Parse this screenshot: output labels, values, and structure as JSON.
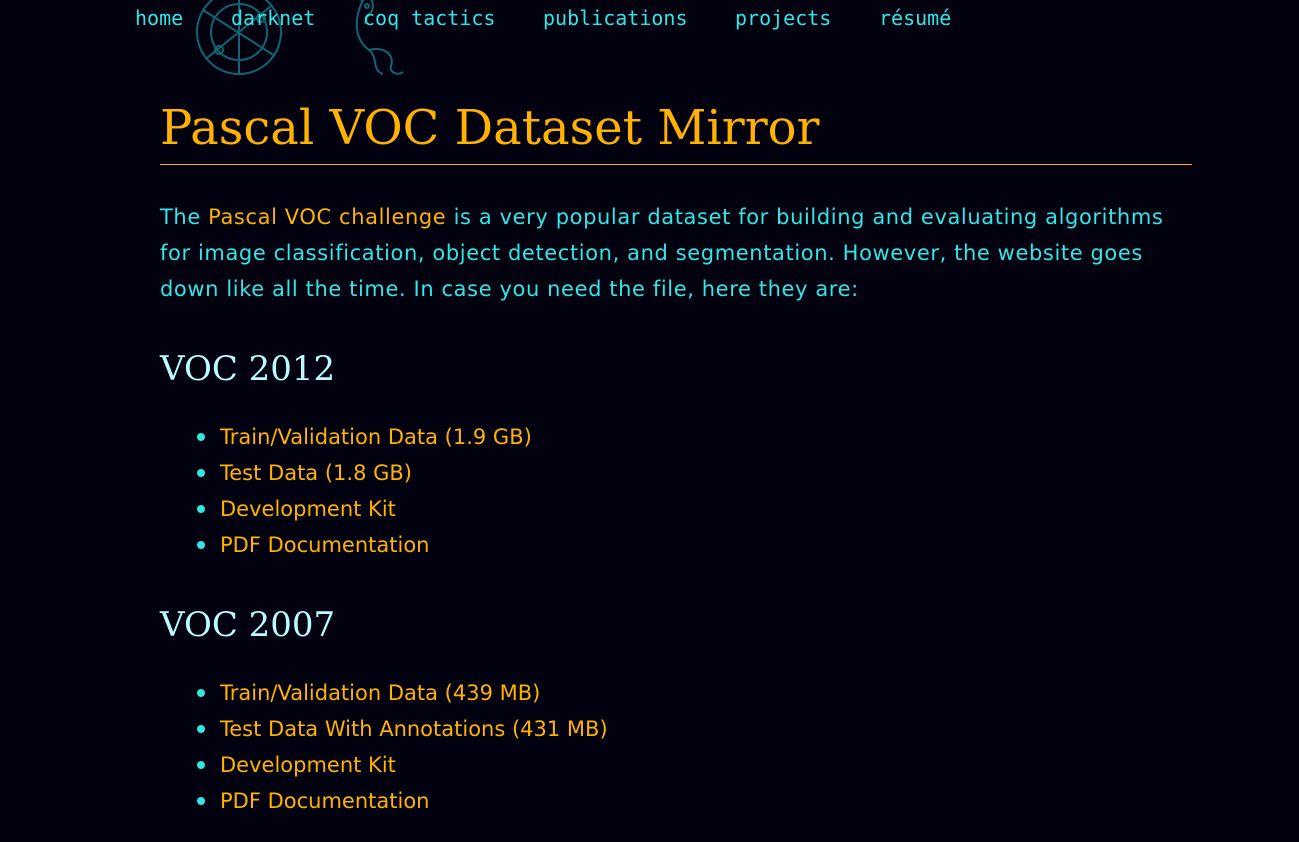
{
  "nav": {
    "items": [
      {
        "label": "home"
      },
      {
        "label": "darknet"
      },
      {
        "label": "coq tactics"
      },
      {
        "label": "publications"
      },
      {
        "label": "projects"
      },
      {
        "label": "résumé"
      }
    ]
  },
  "page": {
    "title": "Pascal VOC Dataset Mirror",
    "intro": {
      "prefix": "The ",
      "link": "Pascal VOC challenge",
      "suffix": " is a very popular dataset for building and evaluating algorithms for image classification, object detection, and segmentation. However, the website goes down like all the time. In case you need the file, here they are:"
    }
  },
  "voc2012": {
    "heading": "VOC 2012",
    "items": [
      {
        "label": "Train/Validation Data (1.9 GB)"
      },
      {
        "label": "Test Data (1.8 GB)"
      },
      {
        "label": "Development Kit"
      },
      {
        "label": "PDF Documentation"
      }
    ]
  },
  "voc2007": {
    "heading": "VOC 2007",
    "items": [
      {
        "label": "Train/Validation Data (439 MB)"
      },
      {
        "label": "Test Data With Annotations (431 MB)"
      },
      {
        "label": "Development Kit"
      },
      {
        "label": "PDF Documentation"
      }
    ]
  },
  "colors": {
    "background": "#02010f",
    "accent_orange": "#ffb300",
    "accent_cyan": "#33e6e6",
    "heading_light": "#b9fbff"
  }
}
